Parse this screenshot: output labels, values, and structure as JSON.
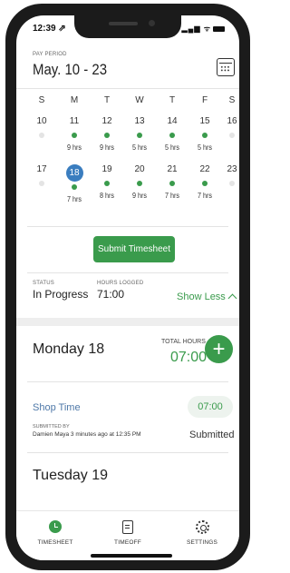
{
  "status_bar": {
    "time": "12:39 ⇗",
    "icons": "▂▄▆ ᯤ"
  },
  "header": {
    "pay_period_label": "PAY PERIOD",
    "pay_period_range": "May. 10 - 23"
  },
  "calendar": {
    "weekdays": [
      "S",
      "M",
      "T",
      "W",
      "T",
      "F",
      "S"
    ],
    "week1": {
      "days": [
        "10",
        "11",
        "12",
        "13",
        "14",
        "15",
        "16"
      ],
      "logged": [
        false,
        true,
        true,
        true,
        true,
        true,
        false
      ],
      "hours": [
        "",
        "9 hrs",
        "9 hrs",
        "5 hrs",
        "5 hrs",
        "5 hrs",
        ""
      ]
    },
    "week2": {
      "days": [
        "17",
        "18",
        "19",
        "20",
        "21",
        "22",
        "23"
      ],
      "logged": [
        false,
        true,
        true,
        true,
        true,
        true,
        false
      ],
      "hours": [
        "",
        "7 hrs",
        "8 hrs",
        "9 hrs",
        "7 hrs",
        "7 hrs",
        ""
      ],
      "selected_index": 1
    }
  },
  "submit_button": "Submit Timesheet",
  "summary": {
    "status_label": "STATUS",
    "status_value": "In Progress",
    "hours_label": "HOURS LOGGED",
    "hours_value": "71:00",
    "toggle_label": "Show Less"
  },
  "day_detail": {
    "title": "Monday 18",
    "total_label": "TOTAL HOURS",
    "total_value": "07:00",
    "add_label": "+"
  },
  "entry": {
    "title": "Shop Time",
    "hours": "07:00",
    "submitted_by_label": "SUBMITTED BY",
    "submitted_by": "Damien Maya  3 minutes ago at 12:35 PM",
    "status": "Submitted"
  },
  "next_day": {
    "title": "Tuesday 19"
  },
  "bottom_nav": {
    "items": [
      {
        "label": "TIMESHEET"
      },
      {
        "label": "TIMEOFF"
      },
      {
        "label": "SETTINGS"
      }
    ]
  },
  "colors": {
    "accent": "#3a9b4c",
    "selected": "#3a7dbf",
    "link": "#4e78a8"
  }
}
